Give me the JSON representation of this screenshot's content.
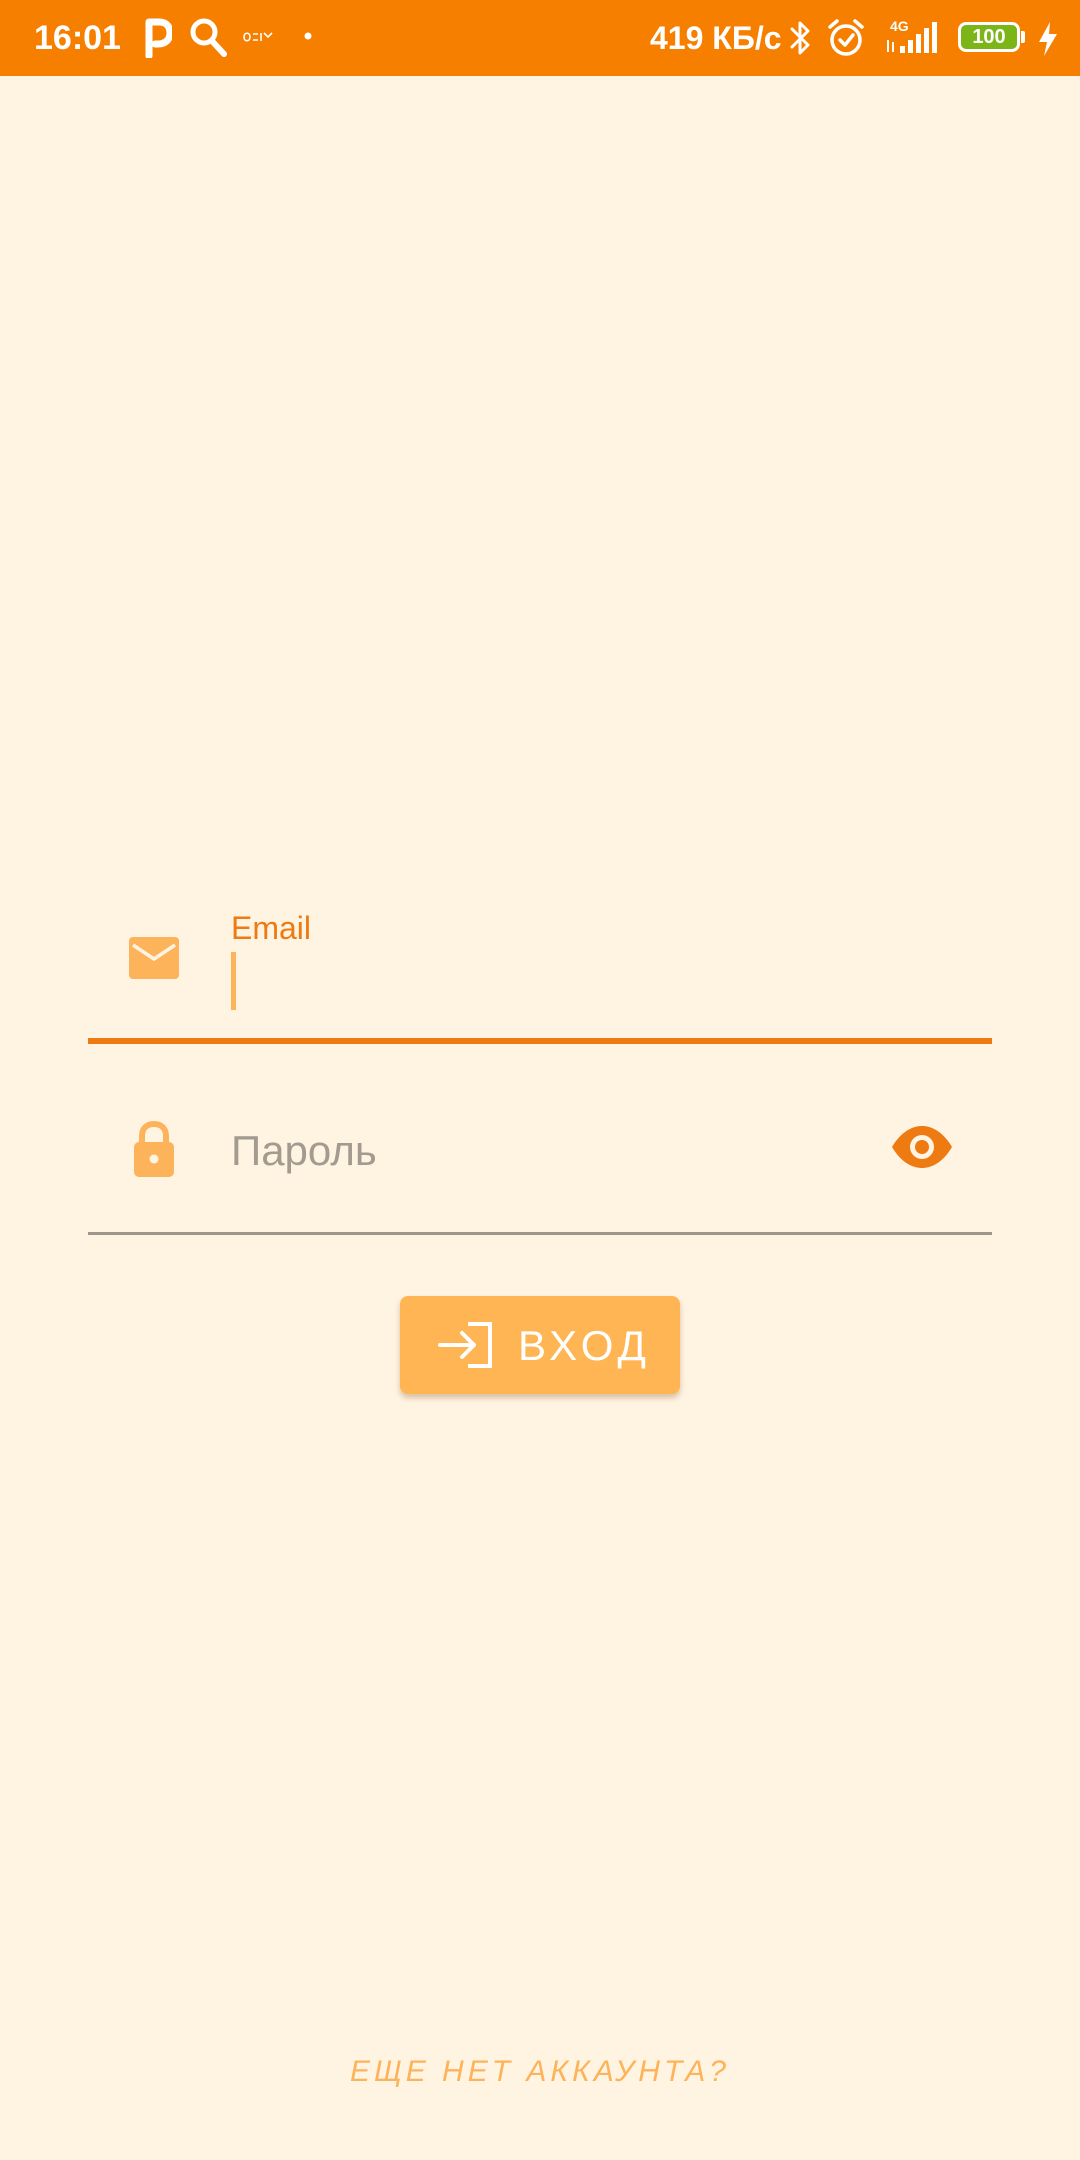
{
  "status_bar": {
    "time": "16:01",
    "network_speed": "419 КБ/с",
    "network_type": "4G",
    "battery_level": "100",
    "icons": [
      "parking-p-icon",
      "search-icon",
      "app-notification-icon",
      "dot-icon",
      "bluetooth-icon",
      "alarm-icon",
      "signal-icon",
      "battery-icon",
      "charging-icon"
    ],
    "background_color": "#F77F00"
  },
  "login_form": {
    "email": {
      "label": "Email",
      "value": "",
      "icon": "envelope-icon"
    },
    "password": {
      "placeholder": "Пароль",
      "value": "",
      "icon": "lock-icon",
      "toggle_icon": "eye-icon"
    },
    "submit": {
      "label": "ВХОД",
      "icon": "login-arrow-icon"
    }
  },
  "footer": {
    "signup_link": "ЕЩЕ НЕТ АККАУНТА?"
  },
  "colors": {
    "background": "#FFF3E2",
    "accent": "#EE7A12",
    "accent_light": "#FFB553",
    "placeholder": "#A39A90"
  }
}
